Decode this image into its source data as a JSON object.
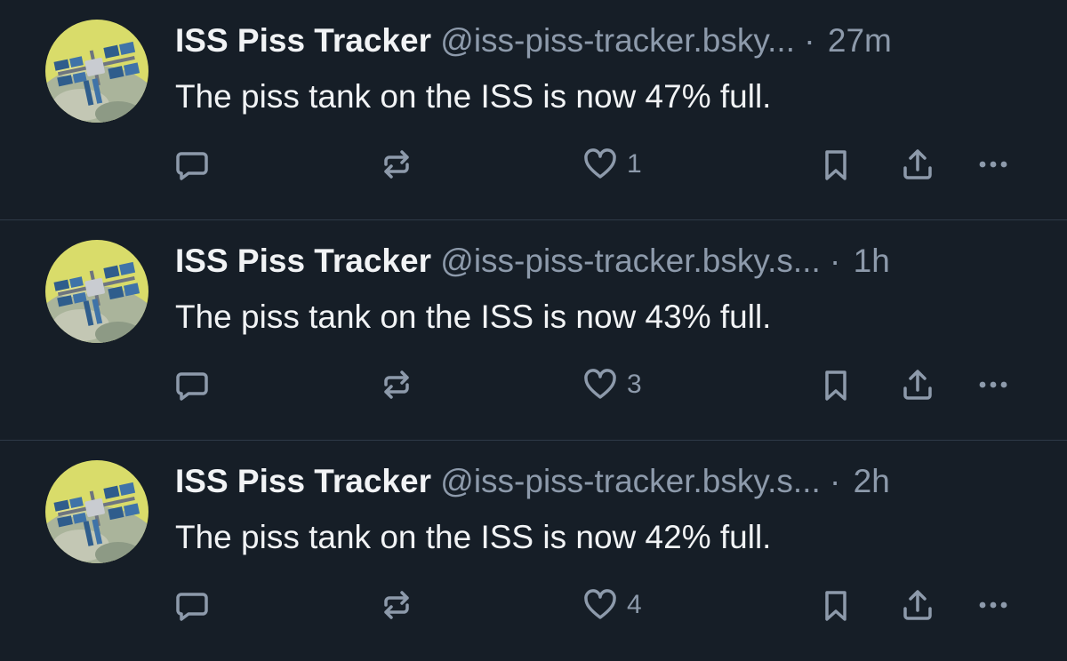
{
  "colors": {
    "background": "#161e27",
    "text_primary": "#f1f3f5",
    "text_secondary": "#8d9aab",
    "divider": "#2e3a48"
  },
  "posts": [
    {
      "author": "ISS Piss Tracker",
      "handle": "@iss-piss-tracker.bsky...",
      "separator": "·",
      "time": "27m",
      "text": "The piss tank on the ISS is now 47% full.",
      "likes": "1",
      "icons": [
        "reply-icon",
        "repost-icon",
        "heart-icon",
        "bookmark-icon",
        "share-icon",
        "more-icon"
      ]
    },
    {
      "author": "ISS Piss Tracker",
      "handle": "@iss-piss-tracker.bsky.s...",
      "separator": "·",
      "time": "1h",
      "text": "The piss tank on the ISS is now 43% full.",
      "likes": "3",
      "icons": [
        "reply-icon",
        "repost-icon",
        "heart-icon",
        "bookmark-icon",
        "share-icon",
        "more-icon"
      ]
    },
    {
      "author": "ISS Piss Tracker",
      "handle": "@iss-piss-tracker.bsky.s...",
      "separator": "·",
      "time": "2h",
      "text": "The piss tank on the ISS is now 42% full.",
      "likes": "4",
      "icons": [
        "reply-icon",
        "repost-icon",
        "heart-icon",
        "bookmark-icon",
        "share-icon",
        "more-icon"
      ]
    }
  ]
}
